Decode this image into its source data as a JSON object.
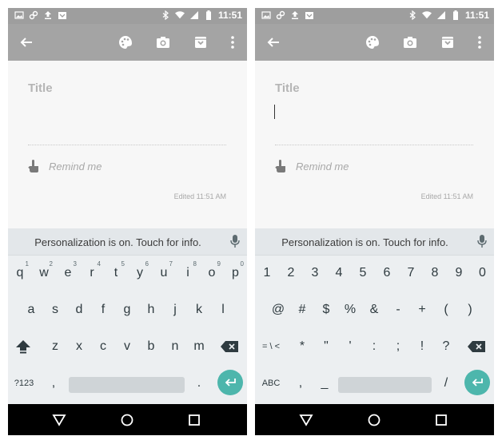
{
  "status": {
    "time": "11:51"
  },
  "note": {
    "title_placeholder": "Title",
    "remind_label": "Remind me",
    "edited": "Edited 11:51 AM"
  },
  "keyboard": {
    "suggestion": "Personalization is on. Touch for info.",
    "left": {
      "row1": [
        {
          "k": "q",
          "h": "1"
        },
        {
          "k": "w",
          "h": "2"
        },
        {
          "k": "e",
          "h": "3"
        },
        {
          "k": "r",
          "h": "4"
        },
        {
          "k": "t",
          "h": "5"
        },
        {
          "k": "y",
          "h": "6"
        },
        {
          "k": "u",
          "h": "7"
        },
        {
          "k": "i",
          "h": "8"
        },
        {
          "k": "o",
          "h": "9"
        },
        {
          "k": "p",
          "h": "0"
        }
      ],
      "row2": [
        "a",
        "s",
        "d",
        "f",
        "g",
        "h",
        "j",
        "k",
        "l"
      ],
      "row3": [
        "z",
        "x",
        "c",
        "v",
        "b",
        "n",
        "m"
      ],
      "mode": "?123",
      "comma": ",",
      "period": "."
    },
    "right": {
      "row1": [
        "1",
        "2",
        "3",
        "4",
        "5",
        "6",
        "7",
        "8",
        "9",
        "0"
      ],
      "row2": [
        "@",
        "#",
        "$",
        "%",
        "&",
        "-",
        "+",
        "(",
        ")"
      ],
      "row3_first": "= \\ <",
      "row3": [
        "*",
        "\"",
        "'",
        ":",
        ";",
        "!",
        "?"
      ],
      "mode": "ABC",
      "comma": ",",
      "underscore": "_",
      "slash": "/"
    }
  },
  "colors": {
    "accent": "#4db6ac",
    "toolbar": "#a4a4a4",
    "statusbar": "#9e9e9e"
  }
}
